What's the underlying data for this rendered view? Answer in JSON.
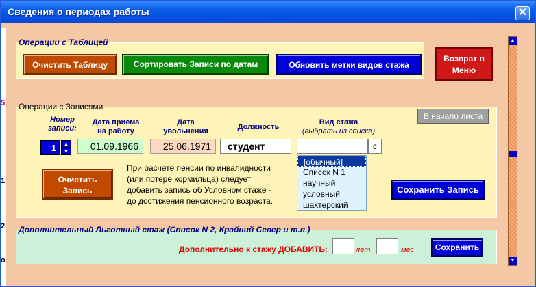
{
  "window": {
    "title": "Сведения о периодах работы",
    "close_label": "✕"
  },
  "left_edge": [
    "5",
    "1",
    "2",
    "о"
  ],
  "table_ops": {
    "legend": "Операции с Таблицей",
    "clear_label": "Очистить Таблицу",
    "sort_label": "Сортировать Записи по датам",
    "refresh_label": "Обновить метки видов стажа",
    "return_line1": "Возврат в",
    "return_line2": "Меню"
  },
  "record_ops": {
    "legend": "Операции с Записями",
    "header_num_1": "Номер",
    "header_num_2": "записи:",
    "header_hire_1": "Дата приема",
    "header_hire_2": "на работу",
    "header_fire_1": "Дата",
    "header_fire_2": "увольнения",
    "header_position": "Должность",
    "header_type": "Вид стажа",
    "header_type_hint": "(выбрать из списка)",
    "to_top_label": "В начало листа",
    "record_number": "1",
    "hire_date": "01.09.1966",
    "fire_date": "25.06.1971",
    "position": "студент",
    "type_value": "",
    "type_button": "c",
    "type_options": [
      "[обычный]",
      "Список N 1",
      "научный",
      "условный",
      "шахтерский"
    ],
    "selected_option": 0,
    "clear_line1": "Очистить",
    "clear_line2": "Запись",
    "note_line1": "При расчете пенсии по инвалидности",
    "note_line2": "(или потере кормильца) следует",
    "note_line3": "добавить запись об Условном стаже -",
    "note_line4": "до достижения пенсионного возраста.",
    "save_label": "Сохранить Запись"
  },
  "extra": {
    "legend": "Дополнительный Льготный стаж   (Список N  2, Крайний Север и т.п.)",
    "add_label": "Дополнительно к стажу ДОБАВИТЬ:",
    "years_value": "",
    "years_unit": "лет",
    "months_value": "",
    "months_unit": "мес",
    "save_label": "Сохранить"
  },
  "colors": {
    "title_bar": "#0a5de8",
    "panel_yellow": "#fff4b8",
    "panel_green": "#ccf0d8",
    "window_bg": "#f4c8a4"
  }
}
